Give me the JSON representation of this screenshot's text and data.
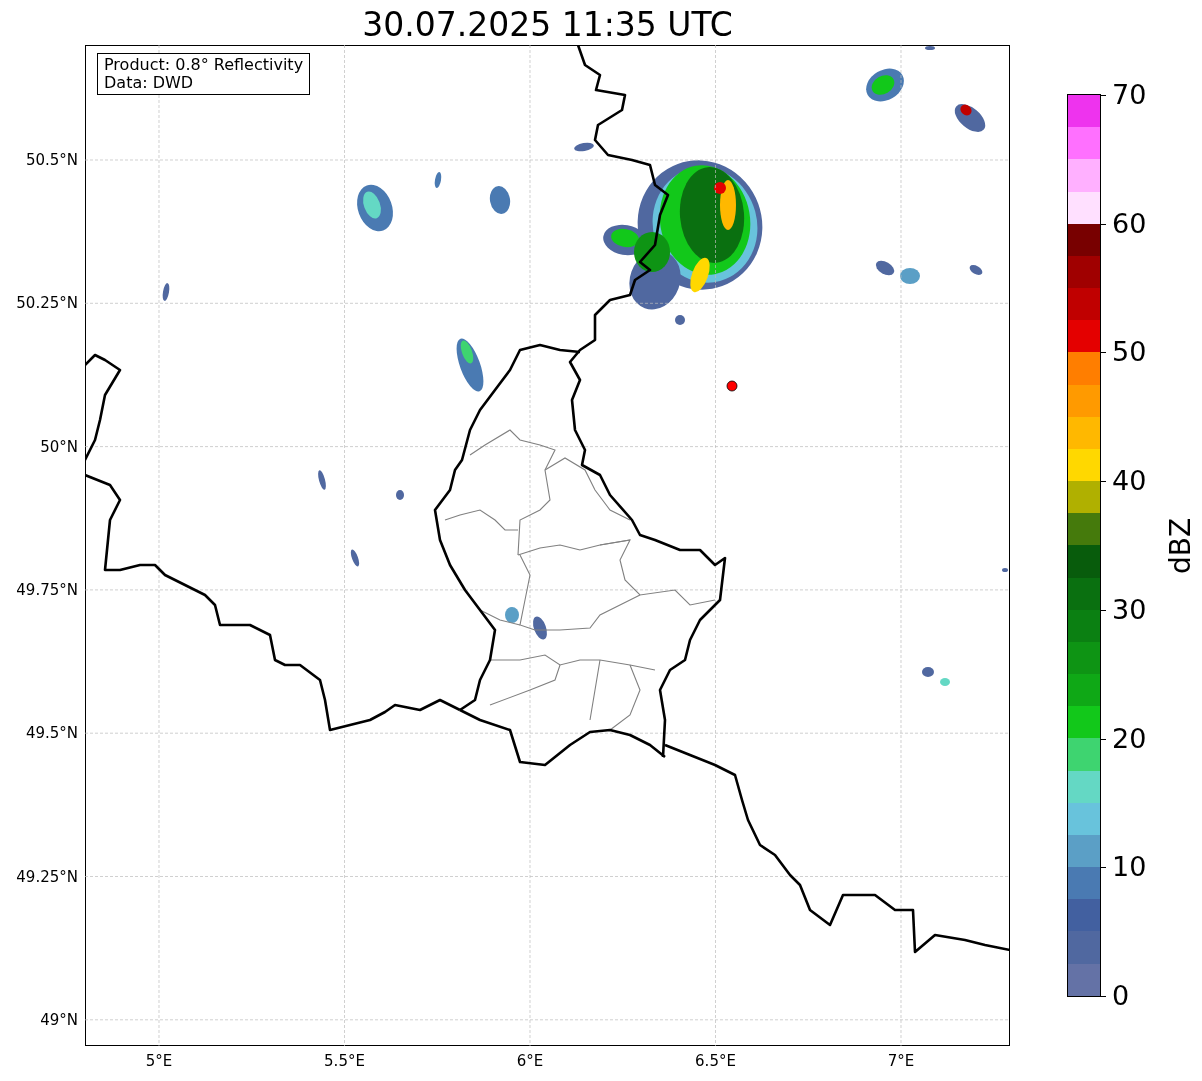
{
  "title": "30.07.2025 11:35 UTC",
  "info_box": {
    "lines": [
      "Product: 0.8° Reflectivity",
      "Data: DWD"
    ]
  },
  "map": {
    "lat_labels": [
      "50.5°N",
      "50.25°N",
      "50°N",
      "49.75°N",
      "49.5°N",
      "49.25°N",
      "49°N"
    ],
    "lon_labels": [
      "5°E",
      "5.5°E",
      "6°E",
      "6.5°E",
      "7°E"
    ]
  },
  "colorbar": {
    "label": "dBZ",
    "ticks": [
      "70",
      "60",
      "50",
      "40",
      "30",
      "20",
      "10",
      "0"
    ],
    "segments": [
      {
        "color": "#ee33ee"
      },
      {
        "color": "#ff70ff"
      },
      {
        "color": "#ffb0ff"
      },
      {
        "color": "#ffe0ff"
      },
      {
        "color": "#780000"
      },
      {
        "color": "#a00000"
      },
      {
        "color": "#c00000"
      },
      {
        "color": "#e40000"
      },
      {
        "color": "#ff7e00"
      },
      {
        "color": "#ff9a00"
      },
      {
        "color": "#ffb800"
      },
      {
        "color": "#ffd800"
      },
      {
        "color": "#b0b000"
      },
      {
        "color": "#457a0c"
      },
      {
        "color": "#085c0c"
      },
      {
        "color": "#0a7010"
      },
      {
        "color": "#0b8012"
      },
      {
        "color": "#0e9414"
      },
      {
        "color": "#0fa816"
      },
      {
        "color": "#12c81a"
      },
      {
        "color": "#3ed470"
      },
      {
        "color": "#64d8c4"
      },
      {
        "color": "#68c3dc"
      },
      {
        "color": "#5b9fc6"
      },
      {
        "color": "#4a7ab2"
      },
      {
        "color": "#4260a0"
      },
      {
        "color": "#5068a0"
      },
      {
        "color": "#6472a6"
      }
    ]
  }
}
